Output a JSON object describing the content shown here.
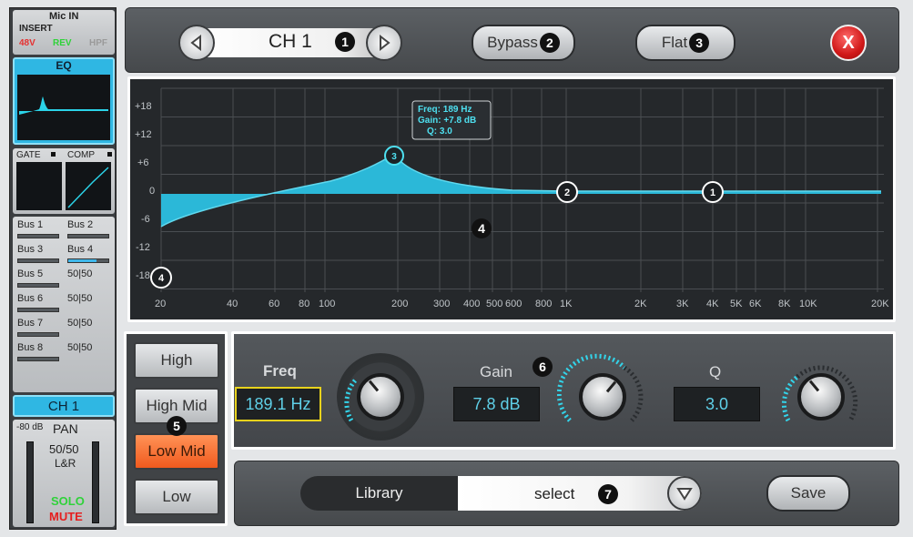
{
  "sidebar": {
    "mic_in": "Mic IN",
    "insert": "INSERT",
    "flags": [
      {
        "label": "48V",
        "color": "#e53030"
      },
      {
        "label": "REV",
        "color": "#2fd23a"
      },
      {
        "label": "HPF",
        "color": "#9a9a9a"
      }
    ],
    "eq_label": "EQ",
    "gate_label": "GATE",
    "comp_label": "COMP",
    "buses": [
      {
        "label": "Bus 1",
        "value": ""
      },
      {
        "label": "Bus 2",
        "value": ""
      },
      {
        "label": "Bus 3",
        "value": ""
      },
      {
        "label": "Bus 4",
        "value": ""
      },
      {
        "label": "Bus 5",
        "value": "50|50"
      },
      {
        "label": "Bus 6",
        "value": "50|50"
      },
      {
        "label": "Bus 7",
        "value": "50|50"
      },
      {
        "label": "Bus 8",
        "value": "50|50"
      }
    ],
    "channel": "CH 1",
    "db": "-80 dB",
    "pan": "PAN",
    "pan_value": "50/50",
    "lr": "L&R",
    "solo": "SOLO",
    "mute": "MUTE"
  },
  "header": {
    "channel": "CH 1",
    "bypass": "Bypass",
    "flat": "Flat",
    "close": "X"
  },
  "callouts": [
    "1",
    "2",
    "3",
    "4",
    "5",
    "6",
    "7"
  ],
  "graph": {
    "tooltip": {
      "freq": "Freq: 189 Hz",
      "gain": "Gain: +7.8 dB",
      "q": "Q: 3.0"
    },
    "y_labels": [
      "+18",
      "+12",
      "+6",
      "0",
      "-6",
      "-12",
      "-18"
    ],
    "x_labels": [
      "20",
      "40",
      "60",
      "80",
      "100",
      "200",
      "300",
      "400",
      "500",
      "600",
      "800",
      "1K",
      "2K",
      "3K",
      "4K",
      "5K",
      "6K",
      "8K",
      "10K",
      "20K"
    ],
    "points": [
      "1",
      "2",
      "3",
      "4"
    ],
    "fill_color": "#2bb8d8"
  },
  "bands": [
    "High",
    "High Mid",
    "Low Mid",
    "Low"
  ],
  "selected_band": "Low Mid",
  "params": [
    {
      "label": "Freq",
      "value": "189.1 Hz"
    },
    {
      "label": "Gain",
      "value": "7.8 dB"
    },
    {
      "label": "Q",
      "value": "3.0"
    }
  ],
  "library": {
    "label": "Library",
    "select": "select",
    "save": "Save"
  }
}
